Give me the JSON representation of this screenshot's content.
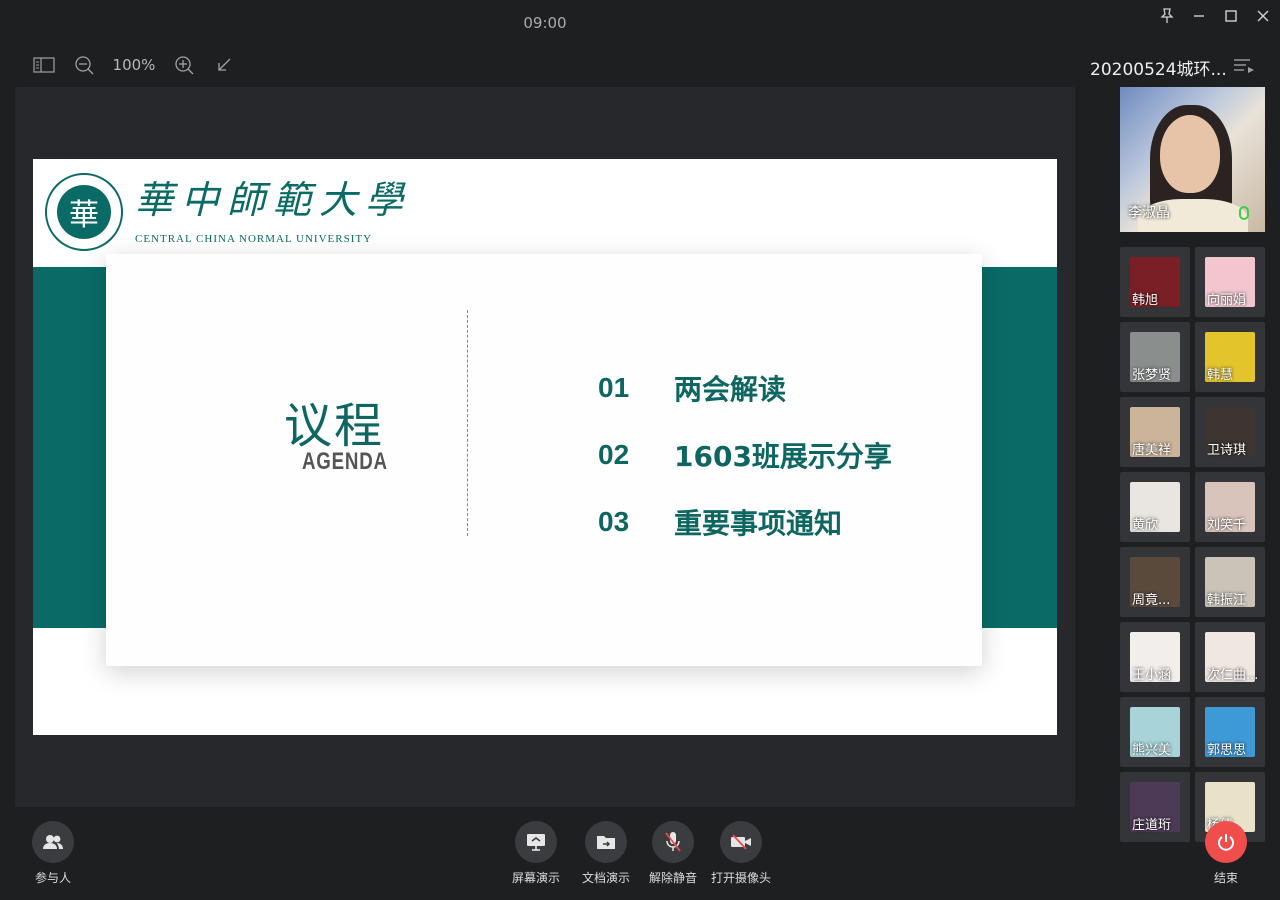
{
  "titlebar": {
    "clock": "09:00"
  },
  "toolbar": {
    "zoom": "100%"
  },
  "slide": {
    "university_cn": "華中師範大學",
    "university_en": "CENTRAL CHINA NORMAL UNIVERSITY",
    "seal_char": "華",
    "agenda_title_cn": "议程",
    "agenda_title_en": "AGENDA",
    "items": [
      {
        "num": "01",
        "title": "两会解读"
      },
      {
        "num": "02",
        "title": "1603班展示分享"
      },
      {
        "num": "03",
        "title": "重要事项通知"
      }
    ]
  },
  "sidebar": {
    "meeting_title": "20200524城环...",
    "main_speaker": "李淑晶",
    "participants": [
      {
        "name": "韩旭",
        "color": "#7a1f25"
      },
      {
        "name": "向丽娟",
        "color": "#f3c6cf"
      },
      {
        "name": "张梦贤",
        "color": "#8a8f8e"
      },
      {
        "name": "韩慧",
        "color": "#e3c42b"
      },
      {
        "name": "唐美祥",
        "color": "#cbb59a"
      },
      {
        "name": "卫诗琪",
        "color": "#3c3532"
      },
      {
        "name": "黄欣",
        "color": "#e9e5e1"
      },
      {
        "name": "刘笑千",
        "color": "#d8c4bb"
      },
      {
        "name": "周竟...",
        "color": "#5a4a3c"
      },
      {
        "name": "韩振江",
        "color": "#c9c3b8"
      },
      {
        "name": "王小涵",
        "color": "#f1eeec"
      },
      {
        "name": "次仁曲...",
        "color": "#f0e6e2"
      },
      {
        "name": "熊兴美",
        "color": "#a7d3d9"
      },
      {
        "name": "郭思思",
        "color": "#3e9ad6"
      },
      {
        "name": "庄道珩",
        "color": "#4d3a56"
      },
      {
        "name": "杨倩",
        "color": "#e9e2c9"
      }
    ]
  },
  "controls": {
    "participants": "参与人",
    "screen_share": "屏幕演示",
    "doc_share": "文档演示",
    "unmute": "解除静音",
    "camera": "打开摄像头",
    "end": "结束"
  }
}
